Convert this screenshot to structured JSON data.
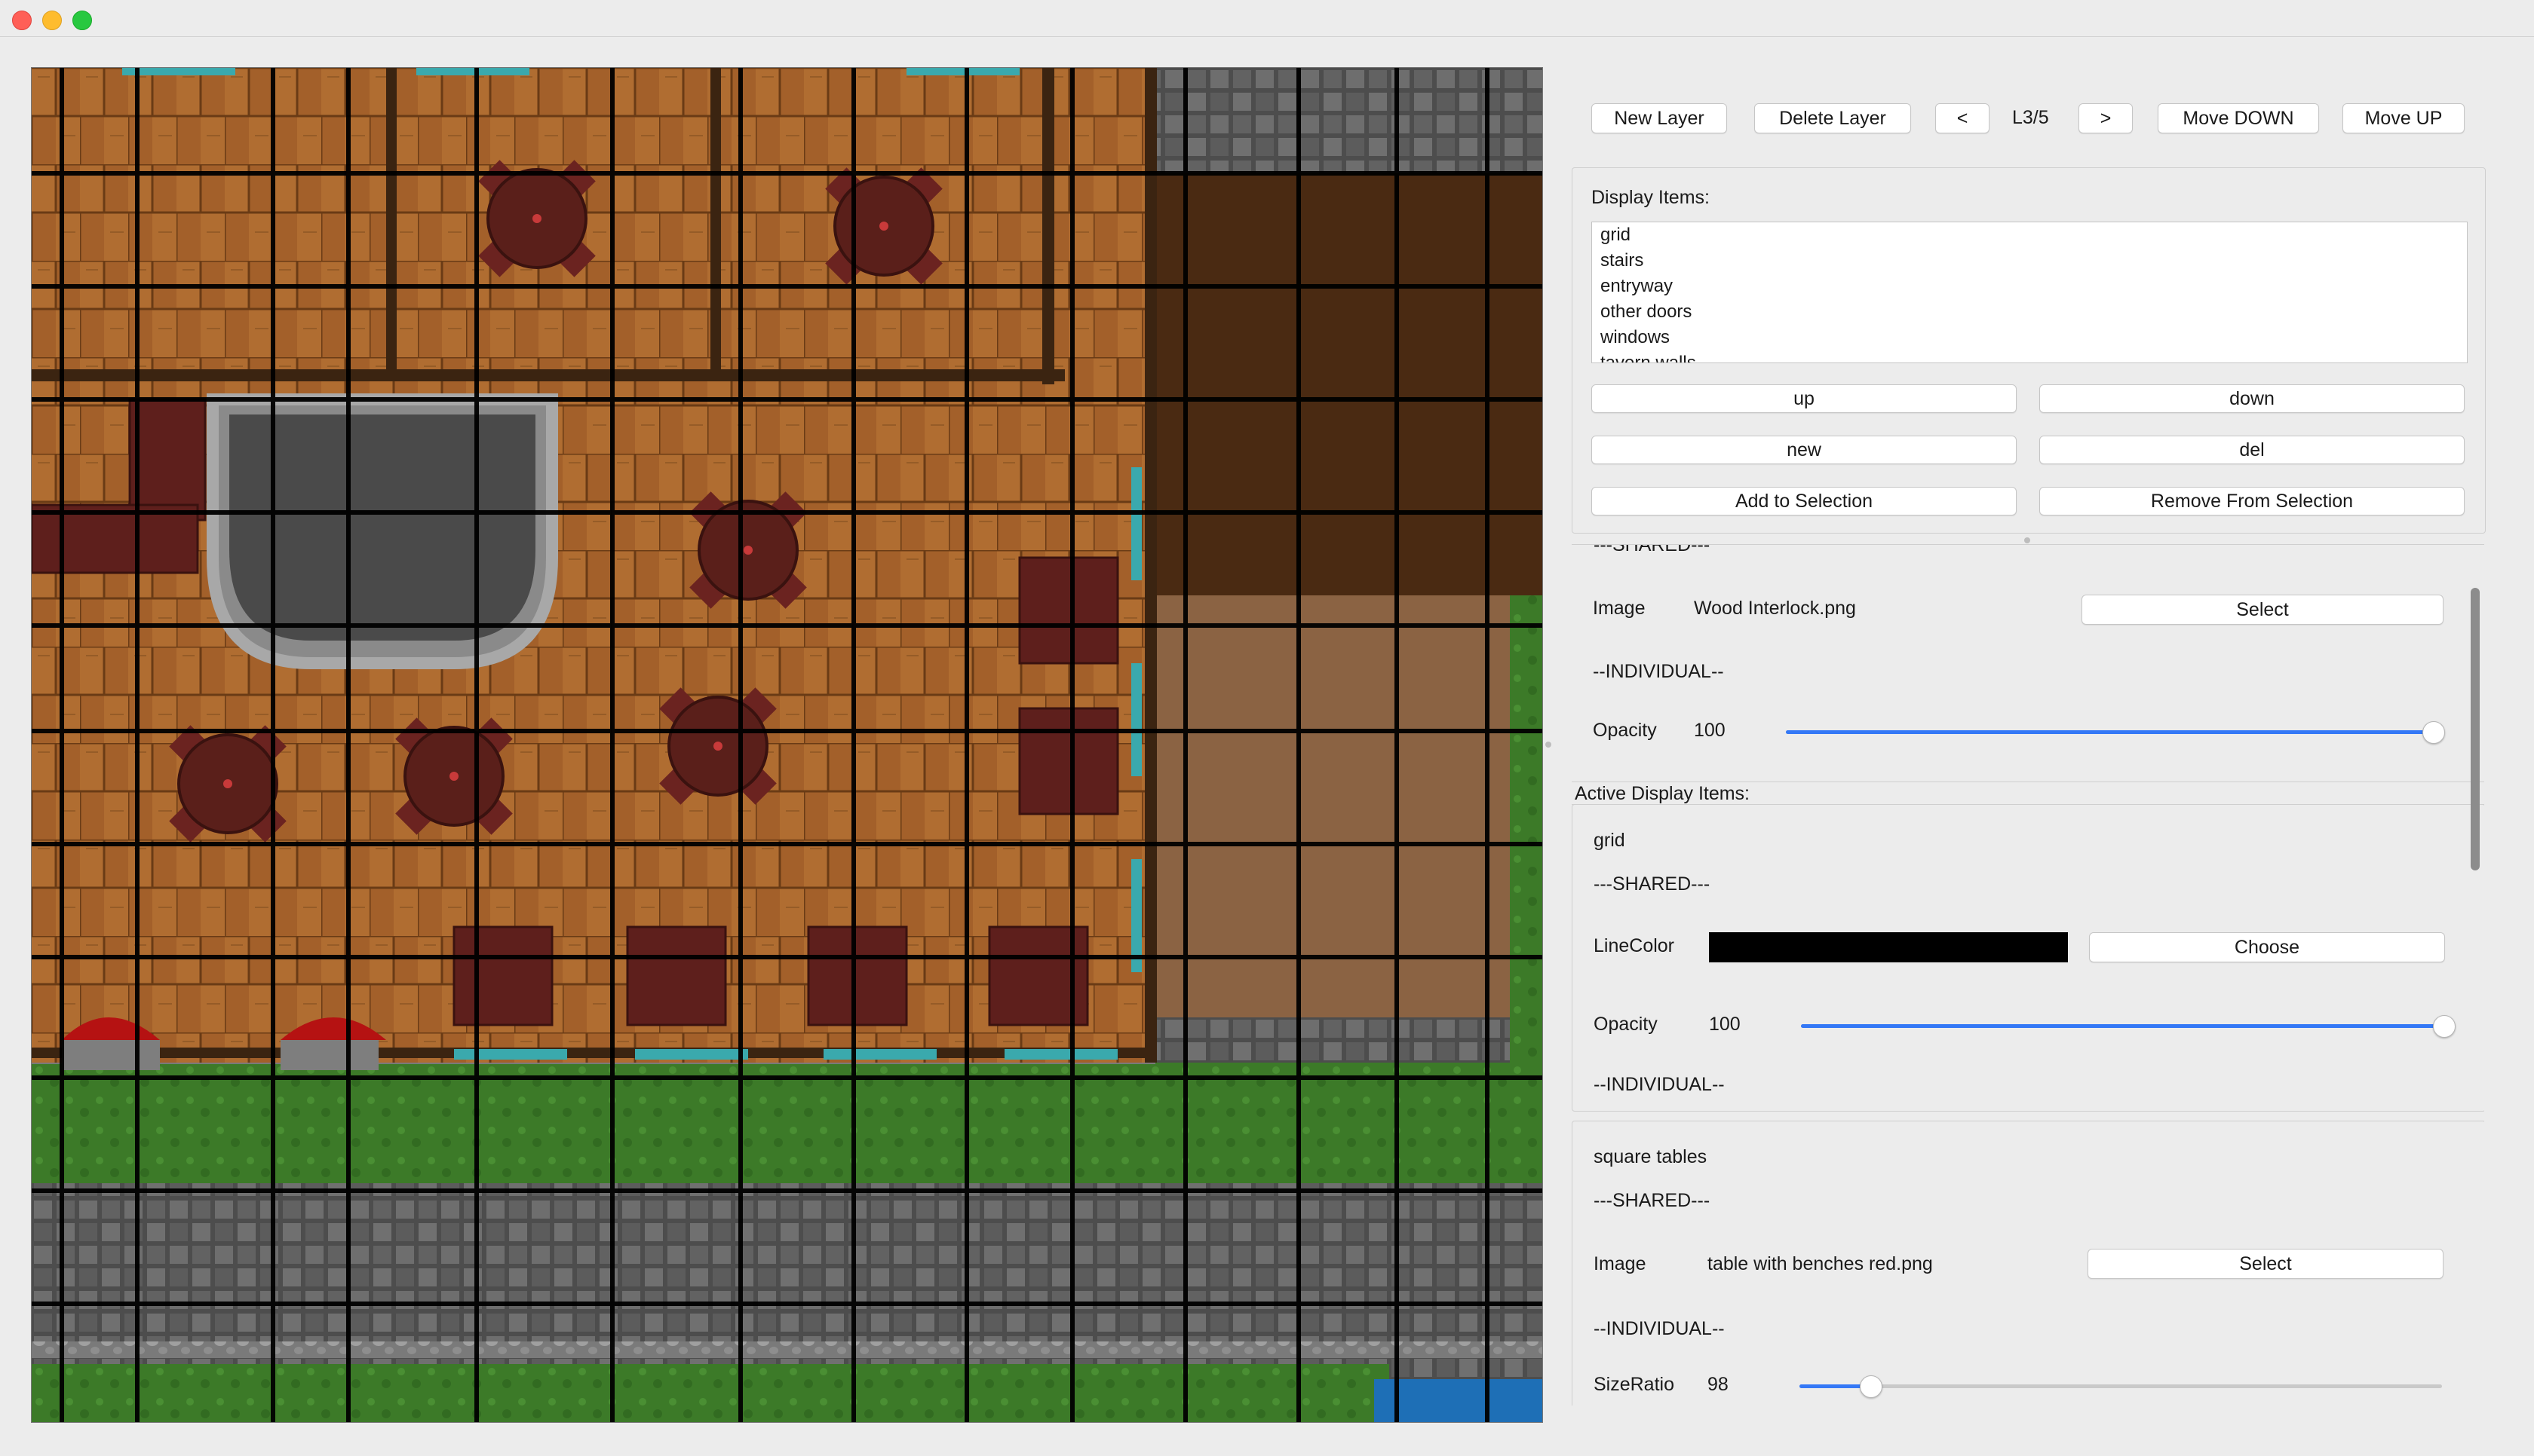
{
  "toolbar": {
    "new_layer": "New Layer",
    "delete_layer": "Delete Layer",
    "prev": "<",
    "layer_indicator": "L3/5",
    "next": ">",
    "move_down": "Move DOWN",
    "move_up": "Move UP"
  },
  "display_items": {
    "label": "Display Items:",
    "items": [
      "grid",
      "stairs",
      "entryway",
      "other doors",
      "windows",
      "tavern walls"
    ],
    "buttons": {
      "up": "up",
      "down": "down",
      "new": "new",
      "del": "del",
      "add_to_selection": "Add to Selection",
      "remove_from_selection": "Remove From Selection"
    }
  },
  "layer_props": {
    "shared_header": "---SHARED---",
    "image_label": "Image",
    "image_value": "Wood Interlock.png",
    "select_label": "Select",
    "individual_header": "--INDIVIDUAL--",
    "opacity_label": "Opacity",
    "opacity_value": "100",
    "opacity_level": 1.0
  },
  "active_items": {
    "label": "Active Display Items:",
    "grid": {
      "name": "grid",
      "shared_header": "---SHARED---",
      "linecolor_label": "LineColor",
      "linecolor": "#000000",
      "choose_label": "Choose",
      "opacity_label": "Opacity",
      "opacity_value": "100",
      "opacity_level": 1.0,
      "individual_header": "--INDIVIDUAL--"
    },
    "square_tables": {
      "name": "square tables",
      "shared_header": "---SHARED---",
      "image_label": "Image",
      "image_value": "table with benches red.png",
      "select_label": "Select",
      "individual_header": "--INDIVIDUAL--",
      "sizeratio_label": "SizeRatio",
      "sizeratio_value": "98",
      "sizeratio_level": 0.11
    }
  },
  "colors": {
    "accent": "#3478f6",
    "window_bg": "#ececec",
    "wood": "#a8662b",
    "stone": "#5b5b5b",
    "grass": "#3e7d2a",
    "table": "#5a1f1a"
  }
}
